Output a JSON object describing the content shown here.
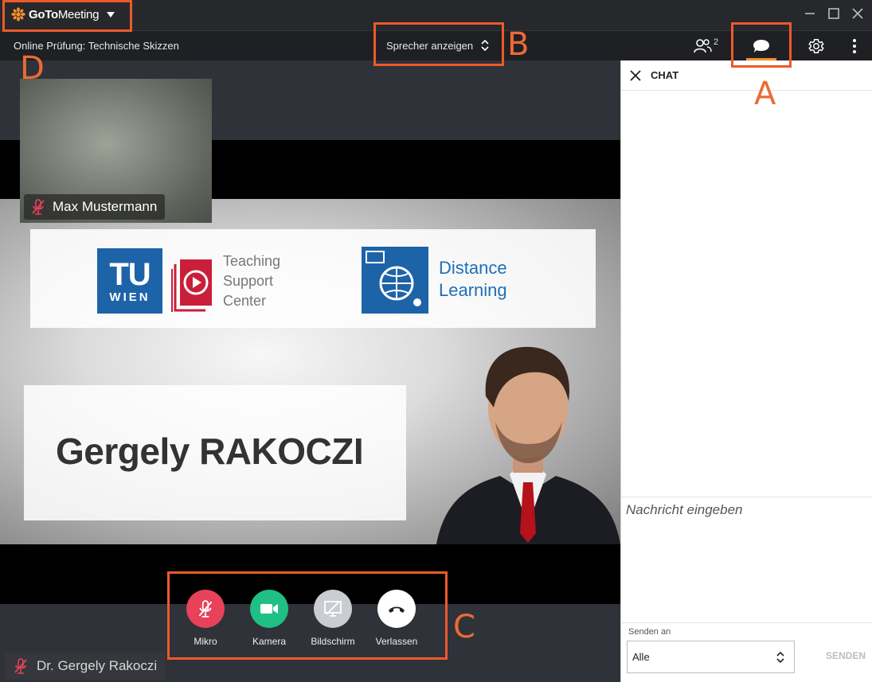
{
  "app": {
    "brand_bold": "GoTo",
    "brand_light": "Meeting"
  },
  "toolbar": {
    "meeting_title": "Online Prüfung: Technische Skizzen",
    "view_mode": "Sprecher anzeigen",
    "attendee_count": "2"
  },
  "stage": {
    "slide": {
      "tu_logo_top": "TU",
      "tu_logo_bottom": "WIEN",
      "tsc_lines": [
        "Teaching",
        "Support",
        "Center"
      ],
      "dl_lines": [
        "Distance",
        "Learning"
      ],
      "presenter_name": "Gergely RAKOCZI"
    },
    "self_tile": {
      "name": "Max Mustermann"
    },
    "presenter_label": "Dr. Gergely Rakoczi"
  },
  "controls": [
    {
      "label": "Mikro",
      "color": "#e8415a"
    },
    {
      "label": "Kamera",
      "color": "#1fbf85"
    },
    {
      "label": "Bildschirm",
      "color": "#c9ccd1"
    },
    {
      "label": "Verlassen",
      "color": "#ffffff"
    }
  ],
  "chat": {
    "title": "CHAT",
    "input_placeholder": "Nachricht eingeben",
    "send_to_label": "Senden an",
    "recipient": "Alle",
    "send_label": "SENDEN"
  },
  "annotations": {
    "a": "A",
    "b": "B",
    "c": "C",
    "d": "D"
  },
  "colors": {
    "accent": "#f68d2e",
    "annotation": "#ec5a2b",
    "brand_blue": "#1d63a8"
  }
}
